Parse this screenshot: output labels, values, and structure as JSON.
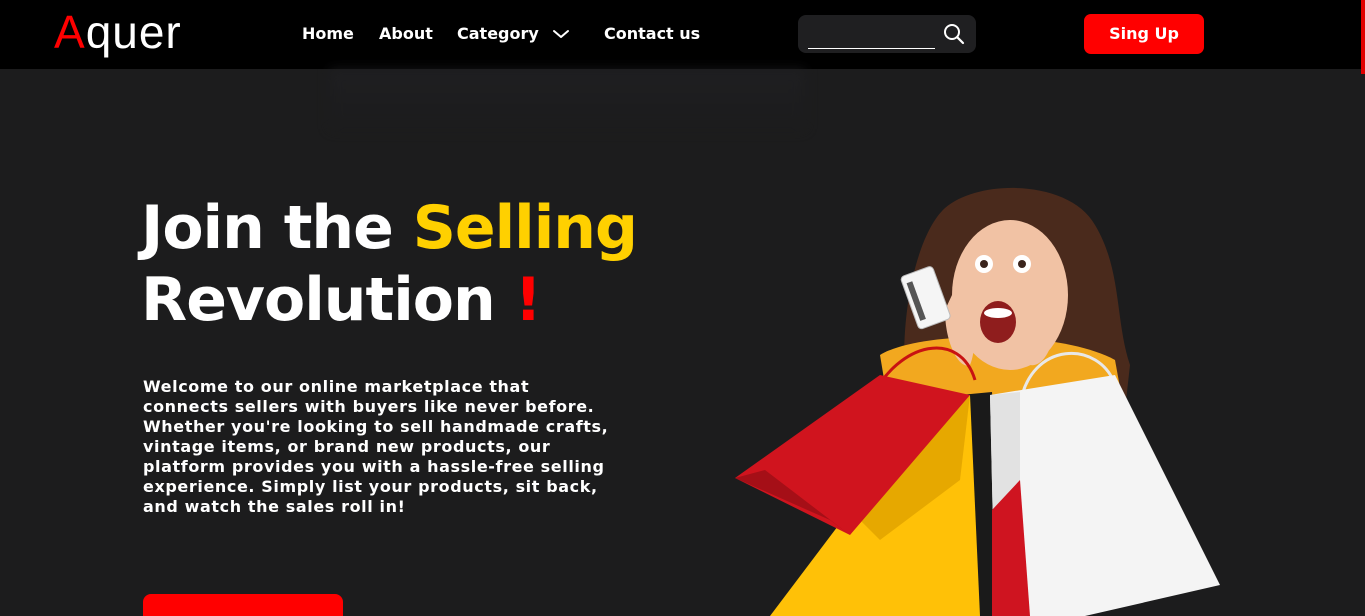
{
  "brand": {
    "first_letter": "A",
    "rest": "quer"
  },
  "nav": {
    "home": "Home",
    "about": "About",
    "category": "Category",
    "contact": "Contact us"
  },
  "search": {
    "value": "",
    "placeholder": ""
  },
  "signup_label": "Sing Up",
  "hero": {
    "title_part1": "Join the ",
    "title_accent": "Selling",
    "title_part2": "Revolution ",
    "title_bang": "!",
    "description": "Welcome to our online marketplace that connects sellers with buyers like never before. Whether you're looking to sell handmade crafts, vintage items, or brand new products, our platform provides you with a hassle-free selling experience. Simply list your products, sit back, and watch the sales roll in!",
    "cta_label": ""
  },
  "colors": {
    "background": "#1c1c1d",
    "navbar": "#000000",
    "accent_red": "#ff0000",
    "accent_yellow": "#ffd000"
  },
  "icons": {
    "search": "search-icon",
    "chevron": "chevron-down-icon"
  }
}
